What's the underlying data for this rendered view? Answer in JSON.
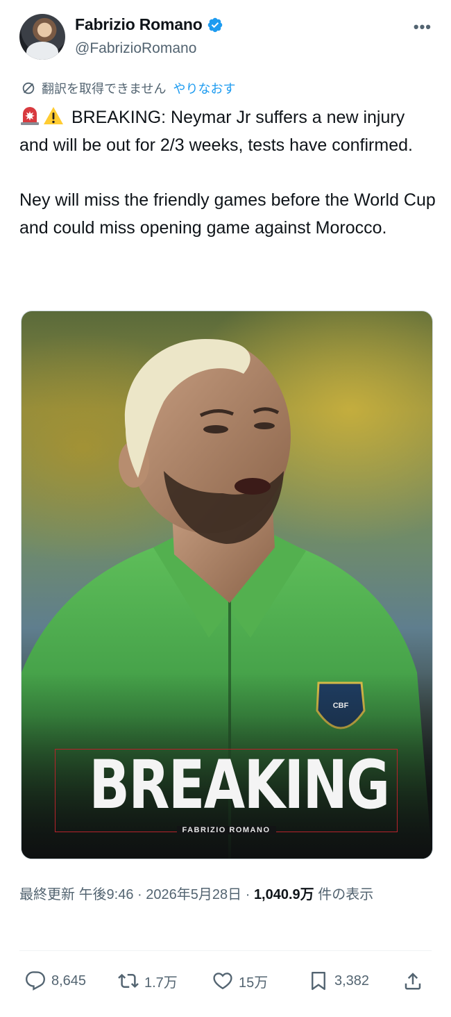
{
  "author": {
    "display_name": "Fabrizio Romano",
    "handle": "@FabrizioRomano",
    "verified": true
  },
  "header": {
    "more_label": "•••"
  },
  "translation": {
    "status": "翻訳を取得できません",
    "retry": "やりなおす"
  },
  "tweet": {
    "line1": "BREAKING: Neymar Jr suffers a new injury and will be out for 2/3 weeks, tests have confirmed.",
    "line2": "Ney will miss the friendly games before the World Cup and could miss opening game against Morocco.",
    "emojis": [
      "rotating-light-icon",
      "warning-icon"
    ]
  },
  "media": {
    "banner_title": "BREAKING",
    "banner_subtitle": "FABRIZIO ROMANO",
    "badge_text": "CBF"
  },
  "meta": {
    "updated_label": "最終更新",
    "time": "午後9:46",
    "sep1": " · ",
    "date": "2026年5月28日",
    "sep2": " · ",
    "views": "1,040.9万",
    "views_label": " 件の表示"
  },
  "actions": {
    "replies": "8,645",
    "reposts": "1.7万",
    "likes": "15万",
    "bookmarks": "3,382"
  },
  "colors": {
    "text": "#0f1419",
    "secondary": "#536471",
    "accent": "#1d9bf0",
    "banner_red": "#b8232b"
  }
}
